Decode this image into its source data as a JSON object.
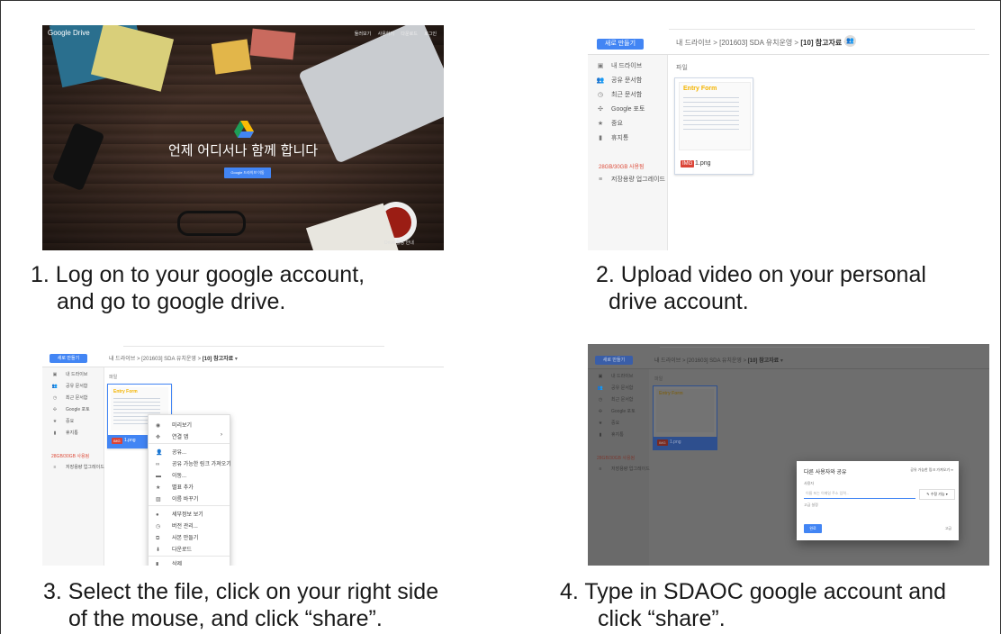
{
  "steps": [
    {
      "caption_line1": "1. Log on to your google account,",
      "caption_line2": "and go to google drive."
    },
    {
      "caption_line1": "2. Upload video on your personal",
      "caption_line2": "drive account."
    },
    {
      "caption_line1": "3. Select the file, click on your right side",
      "caption_line2": "of the mouse,   and click “share”."
    },
    {
      "caption_line1": "4. Type in SDAOC google account and",
      "caption_line2": "click “share”."
    }
  ],
  "landing": {
    "logo": "Google Drive",
    "top_links": [
      "둘러보기",
      "사용하기",
      "다운로드",
      "로그인"
    ],
    "headline": "언제 어디서나 함께 합니다",
    "cta": "Google 드라이브 이동",
    "corner_text": "Drive 활용 안내"
  },
  "drive": {
    "new_button": "새로 만들기",
    "breadcrumb_root": "내 드라이브",
    "breadcrumb_mid": "[201603] SDA 유치운영",
    "breadcrumb_current": "[10] 참고자료",
    "section_label": "파일",
    "storage_text": "28GB/30GB 사용됨",
    "upgrade_text": "저장용량 업그레이드",
    "sidebar": [
      {
        "icon": "drive-icon",
        "label": "내 드라이브"
      },
      {
        "icon": "shared-icon",
        "label": "공유 문서함"
      },
      {
        "icon": "clock-icon",
        "label": "최근 문서함"
      },
      {
        "icon": "photos-icon",
        "label": "Google 포토"
      },
      {
        "icon": "star-icon",
        "label": "중요"
      },
      {
        "icon": "trash-icon",
        "label": "휴지통"
      }
    ],
    "file": {
      "name": "1.png",
      "type_badge": "IMG",
      "thumb_title": "Entry Form"
    }
  },
  "context_menu": {
    "items": [
      {
        "icon": "eye-icon",
        "label": "미리보기"
      },
      {
        "icon": "open-with-icon",
        "label": "연결 앱"
      },
      {
        "icon": "add-person-icon",
        "label": "공유..."
      },
      {
        "icon": "link-icon",
        "label": "공유 가능한 링크 가져오기"
      },
      {
        "icon": "folder-move-icon",
        "label": "이동..."
      },
      {
        "icon": "star-icon",
        "label": "별표 추가"
      },
      {
        "icon": "rename-icon",
        "label": "이름 바꾸기"
      },
      {
        "icon": "info-icon",
        "label": "세부정보 보기"
      },
      {
        "icon": "history-icon",
        "label": "버전 관리..."
      },
      {
        "icon": "copy-icon",
        "label": "사본 만들기"
      },
      {
        "icon": "download-icon",
        "label": "다운로드"
      },
      {
        "icon": "delete-icon",
        "label": "삭제"
      }
    ]
  },
  "share_dialog": {
    "title": "다른 사용자와 공유",
    "get_link": "공유 가능한 링크 가져오기",
    "people_label": "사용자",
    "input_placeholder": "이름 또는 이메일 주소 입력...",
    "permission": "수정 가능",
    "note": "고급 설정",
    "done_button": "완료",
    "advanced": "고급"
  },
  "colors": {
    "accent": "#4285f4",
    "danger": "#db4437",
    "storage": "#dd4b39",
    "frame": "#333333"
  }
}
